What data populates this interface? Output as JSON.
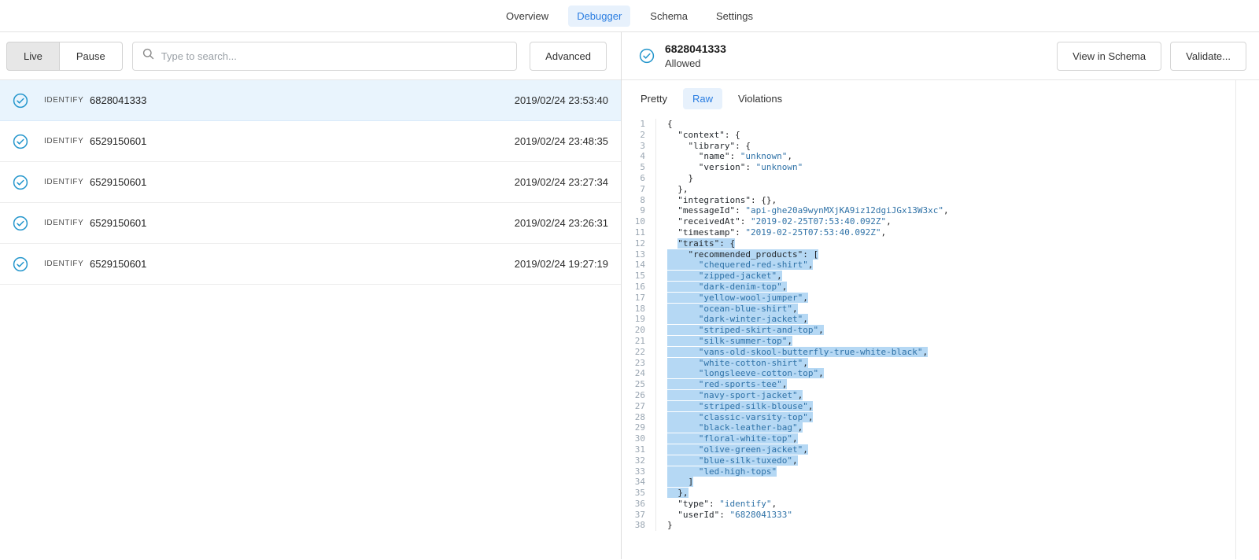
{
  "nav": {
    "items": [
      {
        "label": "Overview",
        "active": false
      },
      {
        "label": "Debugger",
        "active": true
      },
      {
        "label": "Schema",
        "active": false
      },
      {
        "label": "Settings",
        "active": false
      }
    ]
  },
  "left_panel": {
    "live_label": "Live",
    "pause_label": "Pause",
    "search_placeholder": "Type to search...",
    "advanced_label": "Advanced",
    "events": [
      {
        "type": "IDENTIFY",
        "id": "6828041333",
        "timestamp": "2019/02/24 23:53:40",
        "selected": true
      },
      {
        "type": "IDENTIFY",
        "id": "6529150601",
        "timestamp": "2019/02/24 23:48:35",
        "selected": false
      },
      {
        "type": "IDENTIFY",
        "id": "6529150601",
        "timestamp": "2019/02/24 23:27:34",
        "selected": false
      },
      {
        "type": "IDENTIFY",
        "id": "6529150601",
        "timestamp": "2019/02/24 23:26:31",
        "selected": false
      },
      {
        "type": "IDENTIFY",
        "id": "6529150601",
        "timestamp": "2019/02/24 19:27:19",
        "selected": false
      }
    ]
  },
  "detail": {
    "title": "6828041333",
    "status": "Allowed",
    "actions": {
      "view_in_schema": "View in Schema",
      "validate": "Validate..."
    },
    "tabs": [
      {
        "label": "Pretty",
        "active": false
      },
      {
        "label": "Raw",
        "active": true
      },
      {
        "label": "Violations",
        "active": false
      }
    ],
    "code": {
      "lines": [
        "{",
        "  \"context\": {",
        "    \"library\": {",
        "      \"name\": \"unknown\",",
        "      \"version\": \"unknown\"",
        "    }",
        "  },",
        "  \"integrations\": {},",
        "  \"messageId\": \"api-ghe20a9wynMXjKA9iz12dgiJGx13W3xc\",",
        "  \"receivedAt\": \"2019-02-25T07:53:40.092Z\",",
        "  \"timestamp\": \"2019-02-25T07:53:40.092Z\",",
        "  \"traits\": {",
        "    \"recommended_products\": [",
        "      \"chequered-red-shirt\",",
        "      \"zipped-jacket\",",
        "      \"dark-denim-top\",",
        "      \"yellow-wool-jumper\",",
        "      \"ocean-blue-shirt\",",
        "      \"dark-winter-jacket\",",
        "      \"striped-skirt-and-top\",",
        "      \"silk-summer-top\",",
        "      \"vans-old-skool-butterfly-true-white-black\",",
        "      \"white-cotton-shirt\",",
        "      \"longsleeve-cotton-top\",",
        "      \"red-sports-tee\",",
        "      \"navy-sport-jacket\",",
        "      \"striped-silk-blouse\",",
        "      \"classic-varsity-top\",",
        "      \"black-leather-bag\",",
        "      \"floral-white-top\",",
        "      \"olive-green-jacket\",",
        "      \"blue-silk-tuxedo\",",
        "      \"led-high-tops\"",
        "    ]",
        "  },",
        "  \"type\": \"identify\",",
        "  \"userId\": \"6828041333\"",
        "}"
      ],
      "selection": {
        "from_line": 12,
        "from_col": 2,
        "to_line": 35
      }
    }
  },
  "colors": {
    "accent_blue": "#2a7de1",
    "tab_active_bg": "#e7f1fc",
    "check_icon_blue": "#2496cc",
    "selected_row_bg": "#e9f4fd",
    "json_string_color": "#2f72a7",
    "code_selection_bg": "#b5d8f4"
  }
}
